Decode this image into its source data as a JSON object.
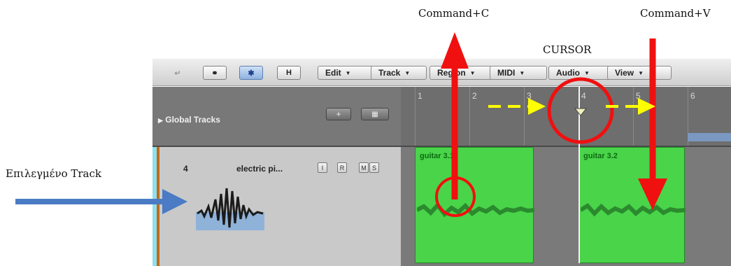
{
  "annotations": {
    "copy_label": "Command+C",
    "paste_label": "Command+V",
    "cursor_label": "CURSOR",
    "selected_track_label": "Επιλεγμένο Track"
  },
  "toolbar": {
    "menus": [
      "Edit",
      "Track",
      "Region",
      "MIDI",
      "Audio",
      "View"
    ],
    "h_button": "H"
  },
  "global_tracks": {
    "label": "Global Tracks",
    "add_button": "+"
  },
  "ruler": {
    "bars": [
      "1",
      "2",
      "3",
      "4",
      "5",
      "6"
    ]
  },
  "track": {
    "number": "4",
    "name": "electric pi...",
    "buttons": [
      "I",
      "R",
      "M",
      "S"
    ]
  },
  "regions": [
    {
      "name": "guitar 3.1",
      "color": "#49d44a"
    },
    {
      "name": "guitar 3.2",
      "color": "#49d44a"
    }
  ],
  "colors": {
    "annotation_red": "#f01010",
    "annotation_yellow": "#ffff00",
    "annotation_blue": "#4a7bc4"
  }
}
